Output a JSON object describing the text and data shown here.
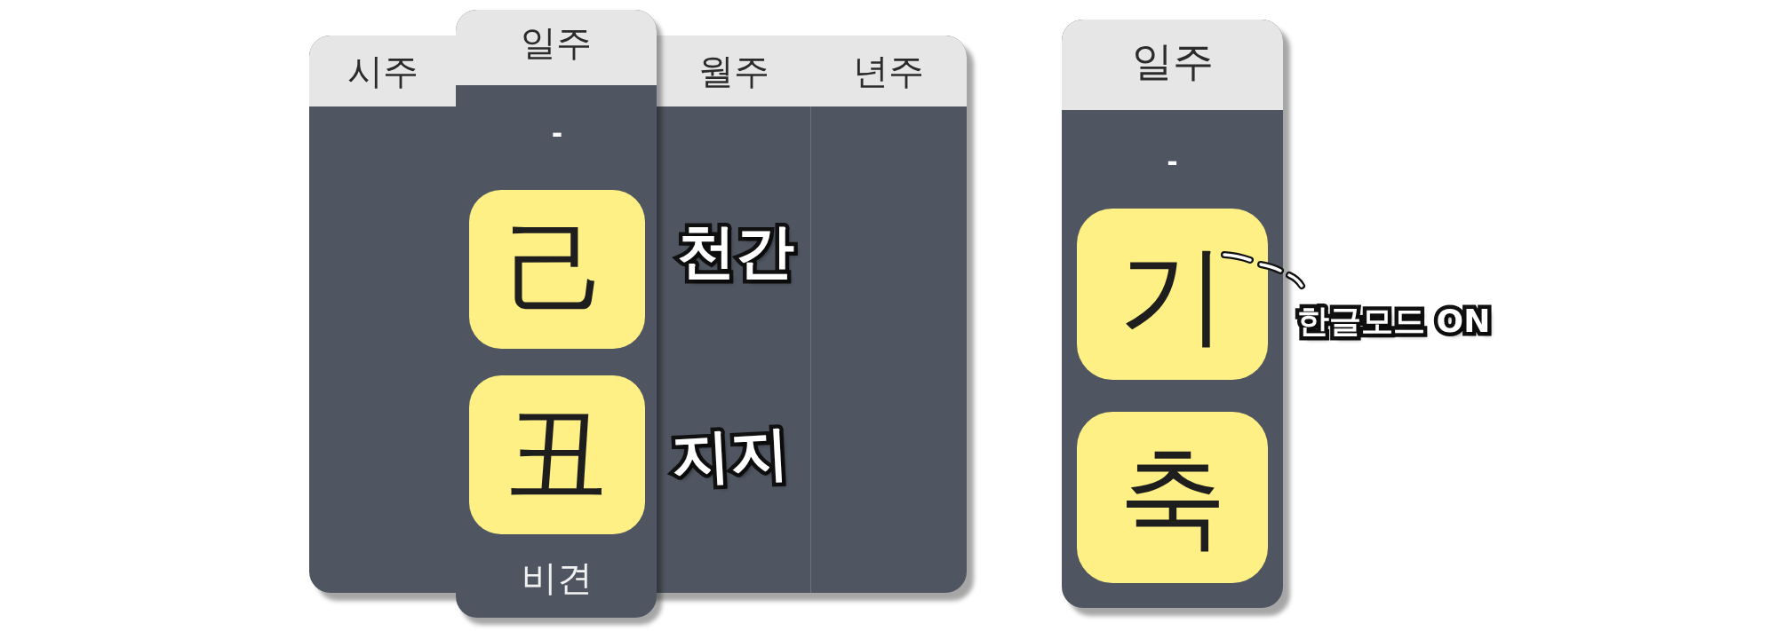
{
  "pillar_table": {
    "columns": [
      {
        "label": "시주",
        "selected": false
      },
      {
        "label": "일주",
        "selected": true,
        "top": "-",
        "stem": "己",
        "branch": "丑",
        "bottom": "비견"
      },
      {
        "label": "월주",
        "selected": false
      },
      {
        "label": "년주",
        "selected": false
      }
    ],
    "stem_note": "천간",
    "branch_note": "지지"
  },
  "hangul_card": {
    "label": "일주",
    "top": "-",
    "stem": "기",
    "branch": "축",
    "note": "한글모드 ON"
  }
}
